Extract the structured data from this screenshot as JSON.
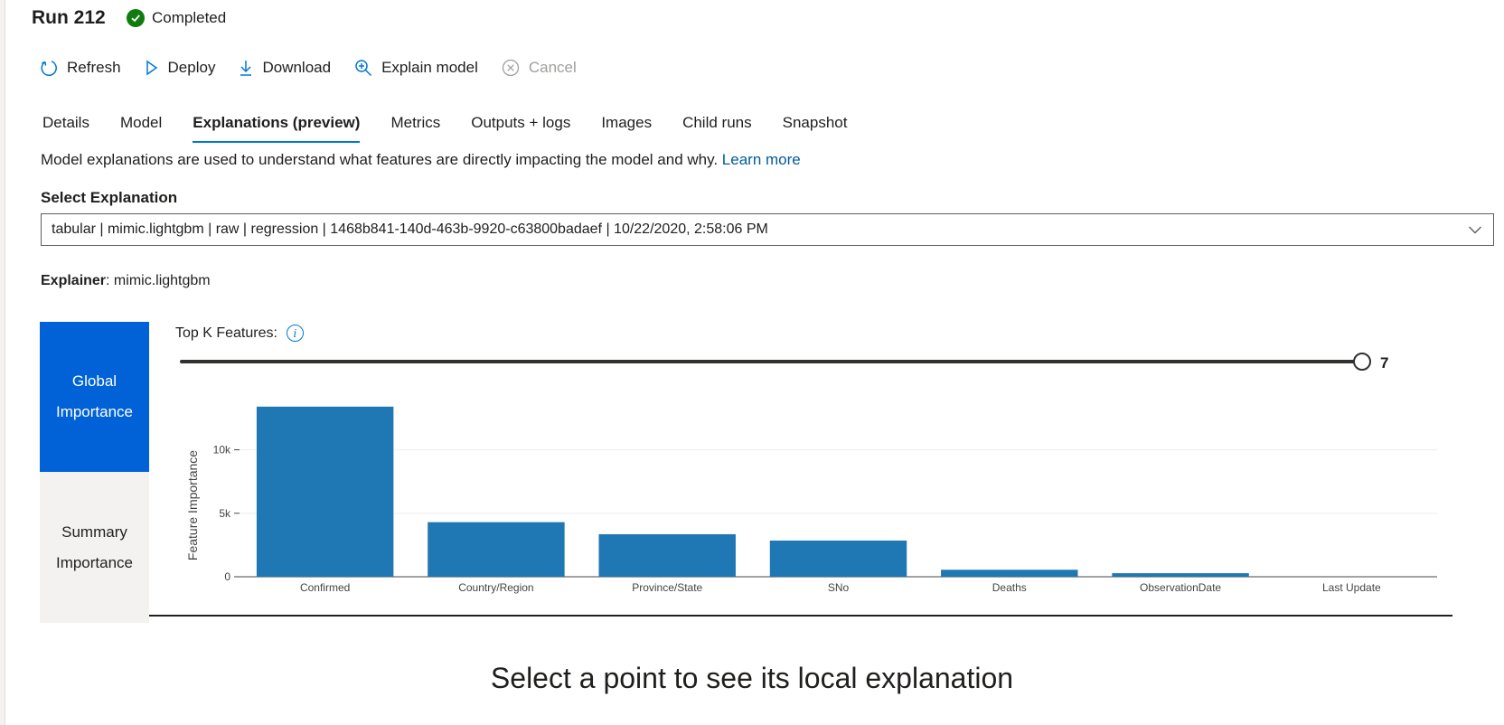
{
  "header": {
    "run_title": "Run 212",
    "status_label": "Completed",
    "status_color": "#107c10"
  },
  "toolbar": {
    "refresh": "Refresh",
    "deploy": "Deploy",
    "download": "Download",
    "explain_model": "Explain model",
    "cancel": "Cancel"
  },
  "tabs": [
    {
      "label": "Details"
    },
    {
      "label": "Model"
    },
    {
      "label": "Explanations (preview)",
      "active": true
    },
    {
      "label": "Metrics"
    },
    {
      "label": "Outputs + logs"
    },
    {
      "label": "Images"
    },
    {
      "label": "Child runs"
    },
    {
      "label": "Snapshot"
    }
  ],
  "description": {
    "text": "Model explanations are used to understand what features are directly impacting the model and why. ",
    "link": "Learn more"
  },
  "select_explanation": {
    "label": "Select Explanation",
    "selected": "tabular | mimic.lightgbm | raw | regression | 1468b841-140d-463b-9920-c63800badaef | 10/22/2020, 2:58:06 PM"
  },
  "explainer": {
    "label": "Explainer",
    "value": " mimic.lightgbm"
  },
  "importance_nav": {
    "global": "Global Importance",
    "summary": "Summary Importance",
    "accent_color": "#0062d6"
  },
  "top_k": {
    "label": "Top K Features:",
    "value": "7"
  },
  "chart_data": {
    "type": "bar",
    "categories": [
      "Confirmed",
      "Country/Region",
      "Province/State",
      "SNo",
      "Deaths",
      "ObservationDate",
      "Last Update"
    ],
    "values": [
      13400,
      4300,
      3350,
      2850,
      550,
      280,
      0
    ],
    "ylabel": "Feature Importance",
    "yticks": [
      0,
      5000,
      10000
    ],
    "ytick_labels": [
      "0",
      "5k",
      "10k"
    ],
    "ylim": [
      0,
      14100
    ],
    "bar_color": "#1f77b4",
    "grid": true
  },
  "local_explanation": {
    "message": "Select a point to see its local explanation"
  }
}
